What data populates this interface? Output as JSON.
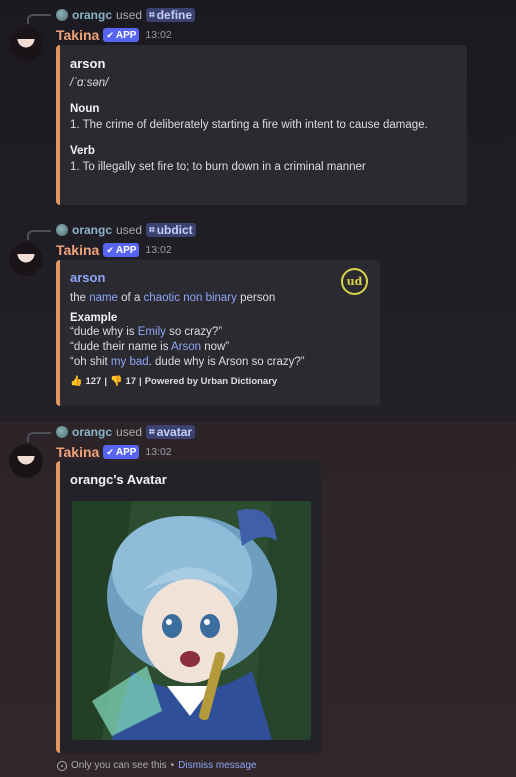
{
  "messages": [
    {
      "command": {
        "user": "orangc",
        "used": "used",
        "name": "define"
      },
      "bot": {
        "name": "Takina",
        "badge": "APP",
        "time": "13:02"
      },
      "embed": {
        "title": "arson",
        "pronunciation": "/ˈɑːsən/",
        "noun_label": "Noun",
        "noun_def": "1. The crime of deliberately starting a fire with intent to cause damage.",
        "verb_label": "Verb",
        "verb_def": "1. To illegally set fire to; to burn down in a criminal manner"
      }
    },
    {
      "command": {
        "user": "orangc",
        "used": "used",
        "name": "ubdict"
      },
      "bot": {
        "name": "Takina",
        "badge": "APP",
        "time": "13:02"
      },
      "embed": {
        "title": "arson",
        "logo": "ud",
        "def_parts": [
          "the ",
          "name",
          " of a ",
          "chaotic",
          " ",
          "non binary",
          " person"
        ],
        "example_label": "Example",
        "example_lines": [
          [
            "“dude why is ",
            "Emily",
            " so crazy?”"
          ],
          [
            "“dude their name is ",
            "Arson",
            " now”"
          ],
          [
            "“oh shit ",
            "my bad",
            ". dude why is Arson so crazy?”"
          ]
        ],
        "footer": {
          "thumbs_up_icon": "thumbs-up-icon",
          "up": "127",
          "sep1": "|",
          "thumbs_down_icon": "thumbs-down-icon",
          "down": "17",
          "sep2": "|",
          "powered": "Powered by Urban Dictionary"
        }
      }
    },
    {
      "command": {
        "user": "orangc",
        "used": "used",
        "name": "avatar"
      },
      "bot": {
        "name": "Takina",
        "badge": "APP",
        "time": "13:02"
      },
      "embed": {
        "title": "orangc's Avatar"
      }
    }
  ],
  "ephemeral": {
    "text": "Only you can see this",
    "dot": "•",
    "dismiss": "Dismiss message"
  },
  "colors": {
    "accent": "#e3965e",
    "link": "#8ea6f5",
    "bot_name": "#f0a37a",
    "app_badge": "#5865f2"
  }
}
